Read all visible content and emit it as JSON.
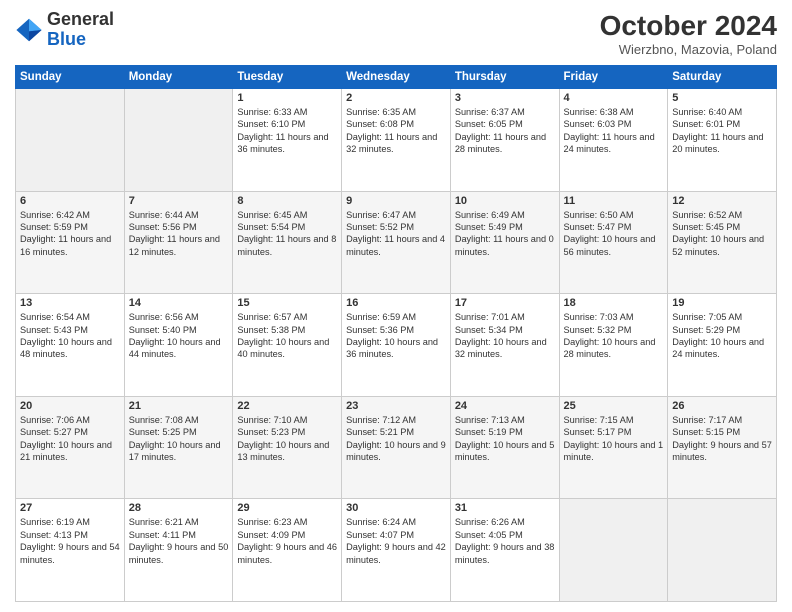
{
  "header": {
    "logo_general": "General",
    "logo_blue": "Blue",
    "month_title": "October 2024",
    "subtitle": "Wierzbno, Mazovia, Poland"
  },
  "days_of_week": [
    "Sunday",
    "Monday",
    "Tuesday",
    "Wednesday",
    "Thursday",
    "Friday",
    "Saturday"
  ],
  "weeks": [
    [
      {
        "day": "",
        "empty": true
      },
      {
        "day": "",
        "empty": true
      },
      {
        "day": "1",
        "sunrise": "Sunrise: 6:33 AM",
        "sunset": "Sunset: 6:10 PM",
        "daylight": "Daylight: 11 hours and 36 minutes."
      },
      {
        "day": "2",
        "sunrise": "Sunrise: 6:35 AM",
        "sunset": "Sunset: 6:08 PM",
        "daylight": "Daylight: 11 hours and 32 minutes."
      },
      {
        "day": "3",
        "sunrise": "Sunrise: 6:37 AM",
        "sunset": "Sunset: 6:05 PM",
        "daylight": "Daylight: 11 hours and 28 minutes."
      },
      {
        "day": "4",
        "sunrise": "Sunrise: 6:38 AM",
        "sunset": "Sunset: 6:03 PM",
        "daylight": "Daylight: 11 hours and 24 minutes."
      },
      {
        "day": "5",
        "sunrise": "Sunrise: 6:40 AM",
        "sunset": "Sunset: 6:01 PM",
        "daylight": "Daylight: 11 hours and 20 minutes."
      }
    ],
    [
      {
        "day": "6",
        "sunrise": "Sunrise: 6:42 AM",
        "sunset": "Sunset: 5:59 PM",
        "daylight": "Daylight: 11 hours and 16 minutes."
      },
      {
        "day": "7",
        "sunrise": "Sunrise: 6:44 AM",
        "sunset": "Sunset: 5:56 PM",
        "daylight": "Daylight: 11 hours and 12 minutes."
      },
      {
        "day": "8",
        "sunrise": "Sunrise: 6:45 AM",
        "sunset": "Sunset: 5:54 PM",
        "daylight": "Daylight: 11 hours and 8 minutes."
      },
      {
        "day": "9",
        "sunrise": "Sunrise: 6:47 AM",
        "sunset": "Sunset: 5:52 PM",
        "daylight": "Daylight: 11 hours and 4 minutes."
      },
      {
        "day": "10",
        "sunrise": "Sunrise: 6:49 AM",
        "sunset": "Sunset: 5:49 PM",
        "daylight": "Daylight: 11 hours and 0 minutes."
      },
      {
        "day": "11",
        "sunrise": "Sunrise: 6:50 AM",
        "sunset": "Sunset: 5:47 PM",
        "daylight": "Daylight: 10 hours and 56 minutes."
      },
      {
        "day": "12",
        "sunrise": "Sunrise: 6:52 AM",
        "sunset": "Sunset: 5:45 PM",
        "daylight": "Daylight: 10 hours and 52 minutes."
      }
    ],
    [
      {
        "day": "13",
        "sunrise": "Sunrise: 6:54 AM",
        "sunset": "Sunset: 5:43 PM",
        "daylight": "Daylight: 10 hours and 48 minutes."
      },
      {
        "day": "14",
        "sunrise": "Sunrise: 6:56 AM",
        "sunset": "Sunset: 5:40 PM",
        "daylight": "Daylight: 10 hours and 44 minutes."
      },
      {
        "day": "15",
        "sunrise": "Sunrise: 6:57 AM",
        "sunset": "Sunset: 5:38 PM",
        "daylight": "Daylight: 10 hours and 40 minutes."
      },
      {
        "day": "16",
        "sunrise": "Sunrise: 6:59 AM",
        "sunset": "Sunset: 5:36 PM",
        "daylight": "Daylight: 10 hours and 36 minutes."
      },
      {
        "day": "17",
        "sunrise": "Sunrise: 7:01 AM",
        "sunset": "Sunset: 5:34 PM",
        "daylight": "Daylight: 10 hours and 32 minutes."
      },
      {
        "day": "18",
        "sunrise": "Sunrise: 7:03 AM",
        "sunset": "Sunset: 5:32 PM",
        "daylight": "Daylight: 10 hours and 28 minutes."
      },
      {
        "day": "19",
        "sunrise": "Sunrise: 7:05 AM",
        "sunset": "Sunset: 5:29 PM",
        "daylight": "Daylight: 10 hours and 24 minutes."
      }
    ],
    [
      {
        "day": "20",
        "sunrise": "Sunrise: 7:06 AM",
        "sunset": "Sunset: 5:27 PM",
        "daylight": "Daylight: 10 hours and 21 minutes."
      },
      {
        "day": "21",
        "sunrise": "Sunrise: 7:08 AM",
        "sunset": "Sunset: 5:25 PM",
        "daylight": "Daylight: 10 hours and 17 minutes."
      },
      {
        "day": "22",
        "sunrise": "Sunrise: 7:10 AM",
        "sunset": "Sunset: 5:23 PM",
        "daylight": "Daylight: 10 hours and 13 minutes."
      },
      {
        "day": "23",
        "sunrise": "Sunrise: 7:12 AM",
        "sunset": "Sunset: 5:21 PM",
        "daylight": "Daylight: 10 hours and 9 minutes."
      },
      {
        "day": "24",
        "sunrise": "Sunrise: 7:13 AM",
        "sunset": "Sunset: 5:19 PM",
        "daylight": "Daylight: 10 hours and 5 minutes."
      },
      {
        "day": "25",
        "sunrise": "Sunrise: 7:15 AM",
        "sunset": "Sunset: 5:17 PM",
        "daylight": "Daylight: 10 hours and 1 minute."
      },
      {
        "day": "26",
        "sunrise": "Sunrise: 7:17 AM",
        "sunset": "Sunset: 5:15 PM",
        "daylight": "Daylight: 9 hours and 57 minutes."
      }
    ],
    [
      {
        "day": "27",
        "sunrise": "Sunrise: 6:19 AM",
        "sunset": "Sunset: 4:13 PM",
        "daylight": "Daylight: 9 hours and 54 minutes."
      },
      {
        "day": "28",
        "sunrise": "Sunrise: 6:21 AM",
        "sunset": "Sunset: 4:11 PM",
        "daylight": "Daylight: 9 hours and 50 minutes."
      },
      {
        "day": "29",
        "sunrise": "Sunrise: 6:23 AM",
        "sunset": "Sunset: 4:09 PM",
        "daylight": "Daylight: 9 hours and 46 minutes."
      },
      {
        "day": "30",
        "sunrise": "Sunrise: 6:24 AM",
        "sunset": "Sunset: 4:07 PM",
        "daylight": "Daylight: 9 hours and 42 minutes."
      },
      {
        "day": "31",
        "sunrise": "Sunrise: 6:26 AM",
        "sunset": "Sunset: 4:05 PM",
        "daylight": "Daylight: 9 hours and 38 minutes."
      },
      {
        "day": "",
        "empty": true
      },
      {
        "day": "",
        "empty": true
      }
    ]
  ]
}
